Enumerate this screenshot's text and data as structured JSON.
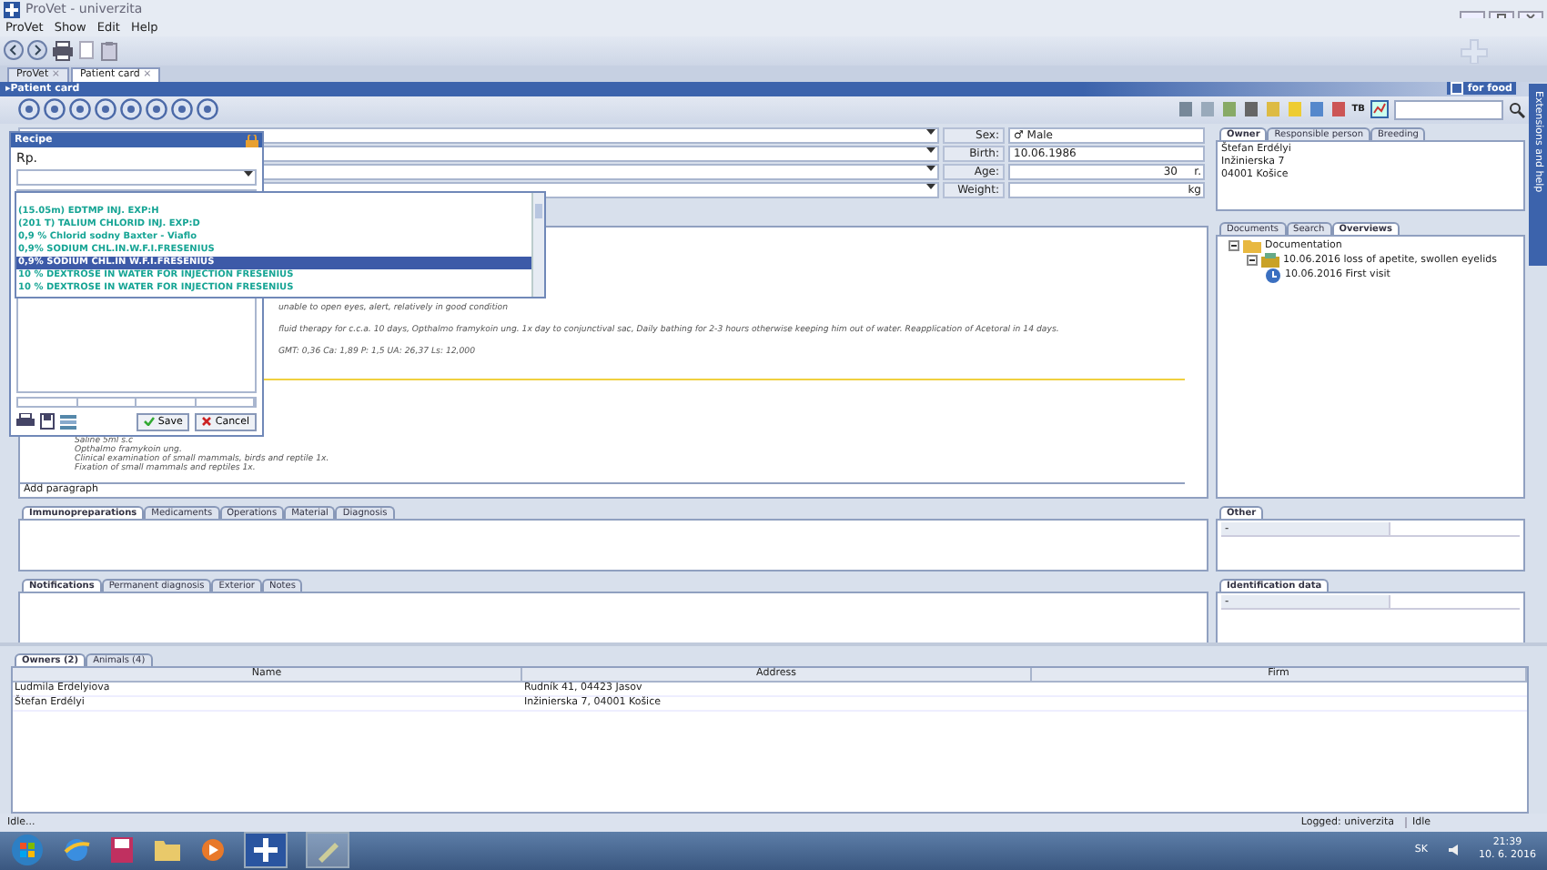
{
  "window": {
    "title": "ProVet - univerzita"
  },
  "menu": [
    "ProVet",
    "Show",
    "Edit",
    "Help"
  ],
  "doc_tabs": [
    {
      "label": "ProVet",
      "close": "×",
      "selected": false
    },
    {
      "label": "Patient card",
      "close": "×",
      "selected": true
    }
  ],
  "panel_title": "Patient card",
  "panel_arrow": "▸",
  "for_food": {
    "label": "for food",
    "checked": false
  },
  "toolbar_text": "TB",
  "fields": {
    "sex": {
      "label": "Sex:",
      "value": "♂ Male"
    },
    "birth": {
      "label": "Birth:",
      "value": "10.06.1986"
    },
    "age": {
      "label": "Age:",
      "value": "30",
      "unit": "r."
    },
    "weight": {
      "label": "Weight:",
      "unit": "kg"
    }
  },
  "owner_tabs": [
    {
      "label": "Owner",
      "selected": true
    },
    {
      "label": "Responsible person",
      "selected": false
    },
    {
      "label": "Breeding",
      "selected": false
    }
  ],
  "owner_lines": [
    "Štefan Erdélyi",
    "Inžinierska 7",
    "04001 Košice"
  ],
  "notes_upper": [
    "unable to open eyes,   alert, relatively in good condition",
    "fluid therapy for c.c.a. 10 days, Opthalmo framykoin ung. 1x day to conjunctival sac, Daily bathing for 2-3 hours otherwise keeping him out of water. Reapplication of Acetoral in 14 days.",
    "GMT: 0,36 Ca: 1,89 P: 1,5 UA: 26,37 Ls: 12,000"
  ],
  "notes_lower": [
    "Saline 5ml s.c",
    "Opthalmo framykoin ung.",
    "Clinical examination of small  mammals, birds and reptile 1x.",
    "Fixation of small mammals  and reptiles 1x."
  ],
  "add_paragraph": "Add paragraph",
  "doc_panel_tabs": [
    {
      "label": "Documents",
      "selected": false
    },
    {
      "label": "Search",
      "selected": false
    },
    {
      "label": "Overviews",
      "selected": true
    }
  ],
  "tree": [
    {
      "label": "Documentation",
      "kind": "folder",
      "expanded": true,
      "children": [
        {
          "label": "10.06.2016 loss of apetite, swollen eyelids",
          "kind": "case",
          "expanded": true,
          "children": [
            {
              "label": "10.06.2016 First visit",
              "kind": "visit"
            }
          ]
        }
      ]
    }
  ],
  "recipe": {
    "title": "Recipe",
    "label": "Rp.",
    "buttons": [
      {
        "label": "Save",
        "kind": "save"
      },
      {
        "label": "Cancel",
        "kind": "cancel"
      }
    ]
  },
  "medicine_list": [
    {
      "name": "(15.05m) EDTMP INJ. EXP:H",
      "selected": false
    },
    {
      "name": "(201 T) TALIUM CHLORID INJ. EXP:D",
      "selected": false
    },
    {
      "name": "0,9 % Chlorid sodny Baxter - Viaflo",
      "selected": false
    },
    {
      "name": "0,9% SODIUM CHL.IN.W.F.I.FRESENIUS",
      "selected": false
    },
    {
      "name": "0,9% SODIUM CHL.IN W.F.I.FRESENIUS",
      "selected": true
    },
    {
      "name": "10 % DEXTROSE IN WATER FOR INJECTION FRESENIUS",
      "selected": false
    },
    {
      "name": "10 % DEXTROSE IN WATER FOR INJECTION FRESENIUS",
      "selected": false
    }
  ],
  "treatment_tabs": [
    {
      "label": "Immunopreparations",
      "selected": true
    },
    {
      "label": "Medicaments",
      "selected": false
    },
    {
      "label": "Operations",
      "selected": false
    },
    {
      "label": "Material",
      "selected": false
    },
    {
      "label": "Diagnosis",
      "selected": false
    }
  ],
  "other": {
    "title": "Other",
    "value": "-"
  },
  "notification_tabs": [
    {
      "label": "Notifications",
      "selected": true
    },
    {
      "label": "Permanent diagnosis",
      "selected": false
    },
    {
      "label": "Exterior",
      "selected": false
    },
    {
      "label": "Notes",
      "selected": false
    }
  ],
  "identification": {
    "title": "Identification data",
    "value": "-"
  },
  "bottom_tabs": [
    {
      "label": "Owners (2)",
      "selected": true
    },
    {
      "label": "Animals (4)",
      "selected": false
    }
  ],
  "owners_table": {
    "columns": [
      "Name",
      "Address",
      "Firm"
    ],
    "rows": [
      {
        "name": "Ludmila Erdelyiova",
        "address": "Rudník 41, 04423 Jasov"
      },
      {
        "name": "Štefan Erdélyi",
        "address": "Inžinierska 7, 04001 Košice"
      }
    ]
  },
  "status": {
    "left": "Idle...",
    "logged": "Logged: univerzita",
    "right": "Idle"
  },
  "side_tab": "Extensions and help",
  "taskbar": {
    "lang": "SK",
    "time": "21:39",
    "date": "10. 6. 2016"
  }
}
